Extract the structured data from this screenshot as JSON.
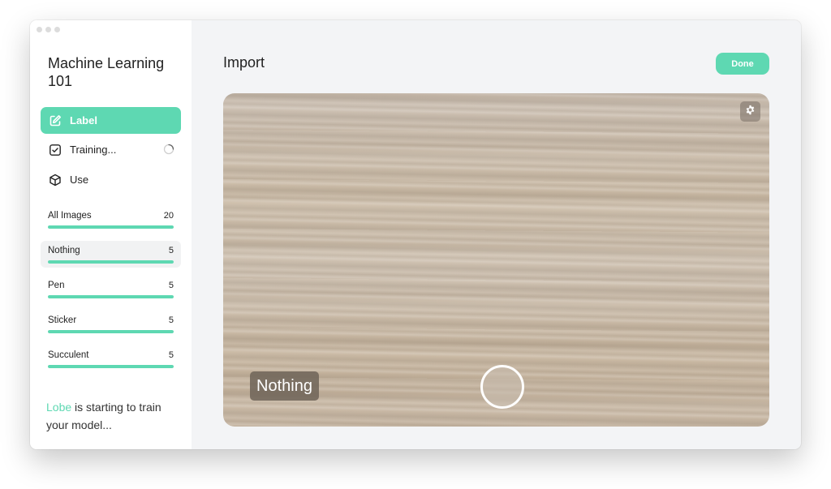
{
  "project": {
    "title": "Machine Learning 101"
  },
  "nav": {
    "items": [
      {
        "label": "Label",
        "icon": "edit-icon",
        "active": true
      },
      {
        "label": "Training...",
        "icon": "checkbox-icon",
        "active": false,
        "loading": true
      },
      {
        "label": "Use",
        "icon": "cube-icon",
        "active": false
      }
    ]
  },
  "labels": [
    {
      "name": "All Images",
      "count": "20",
      "progress": 1.0,
      "selected": false
    },
    {
      "name": "Nothing",
      "count": "5",
      "progress": 1.0,
      "selected": true
    },
    {
      "name": "Pen",
      "count": "5",
      "progress": 1.0,
      "selected": false
    },
    {
      "name": "Sticker",
      "count": "5",
      "progress": 1.0,
      "selected": false
    },
    {
      "name": "Succulent",
      "count": "5",
      "progress": 1.0,
      "selected": false
    }
  ],
  "status": {
    "brand": "Lobe",
    "message": " is starting to train your model..."
  },
  "main": {
    "title": "Import",
    "done_label": "Done",
    "prediction": "Nothing"
  },
  "colors": {
    "accent": "#5ed8b2",
    "sidebar_bg": "#ffffff",
    "main_bg": "#f3f4f6"
  }
}
